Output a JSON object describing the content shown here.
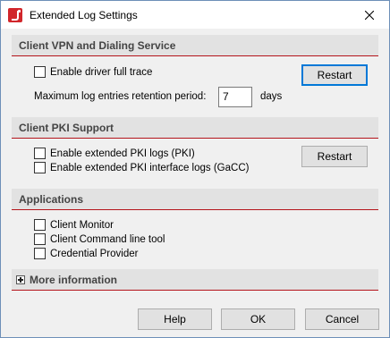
{
  "window": {
    "title": "Extended Log Settings"
  },
  "vpn_section": {
    "header": "Client VPN and Dialing Service",
    "driver_trace_label": "Enable driver full trace",
    "restart_label": "Restart",
    "retention_label": "Maximum log entries retention period:",
    "retention_value": "7",
    "retention_unit": "days"
  },
  "pki_section": {
    "header": "Client PKI Support",
    "pki_logs_label": "Enable extended PKI logs (PKI)",
    "pki_interface_label": "Enable extended PKI interface logs (GaCC)",
    "restart_label": "Restart"
  },
  "apps_section": {
    "header": "Applications",
    "items": [
      "Client Monitor",
      "Client Command line tool",
      "Credential Provider"
    ]
  },
  "more_info": {
    "label": "More information"
  },
  "buttons": {
    "help": "Help",
    "ok": "OK",
    "cancel": "Cancel"
  }
}
